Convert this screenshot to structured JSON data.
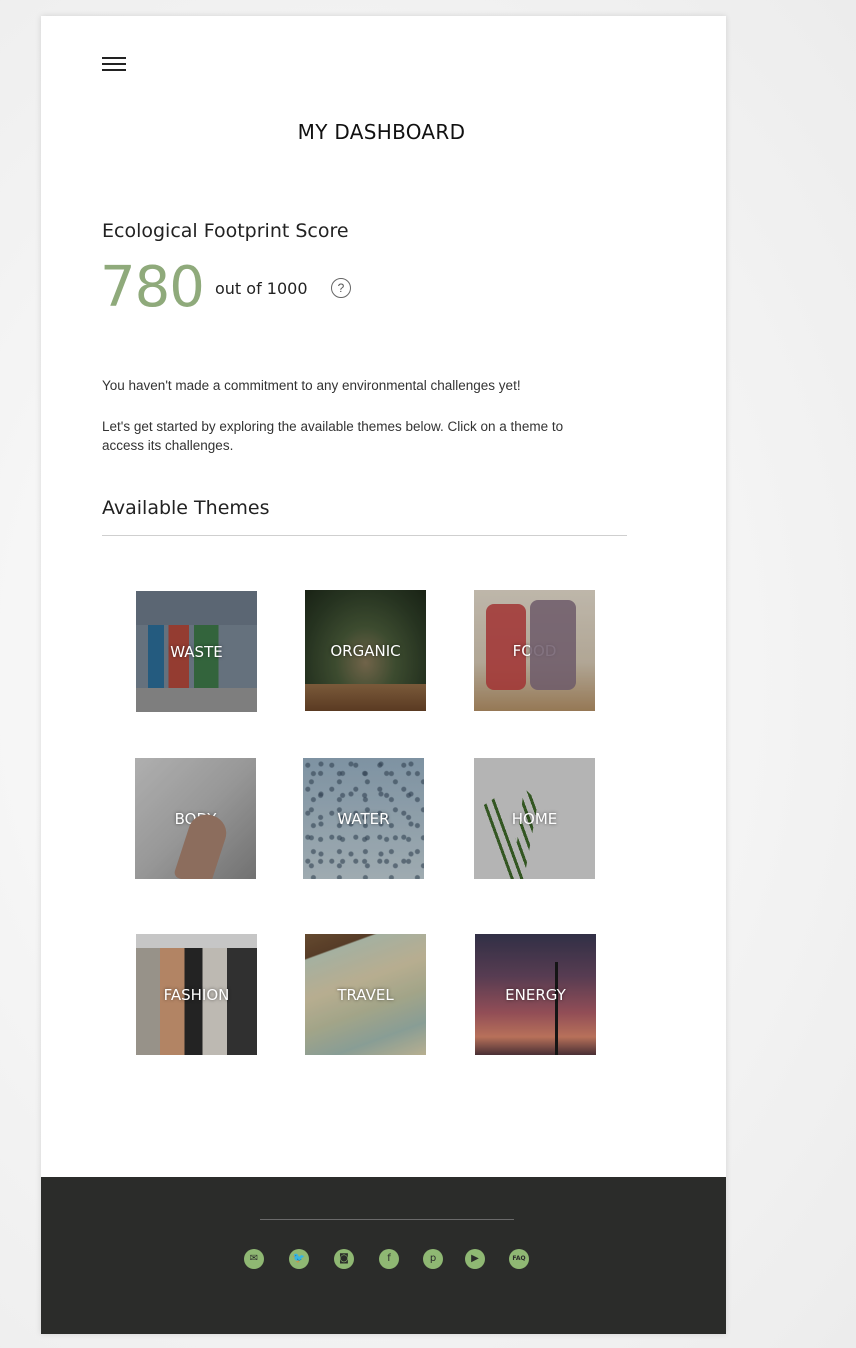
{
  "header": {
    "title": "MY DASHBOARD"
  },
  "score": {
    "heading": "Ecological Footprint Score",
    "value": "780",
    "out_of": "out of 1000",
    "help_symbol": "?"
  },
  "messages": {
    "no_commitment": "You haven't made a commitment to any environmental challenges yet!",
    "get_started": "Let's get started by exploring the available themes below. Click on a theme to access its challenges."
  },
  "themes": {
    "heading": "Available Themes",
    "items": [
      {
        "label": "WASTE"
      },
      {
        "label": "ORGANIC"
      },
      {
        "label": "FOOD"
      },
      {
        "label": "BODY"
      },
      {
        "label": "WATER"
      },
      {
        "label": "HOME"
      },
      {
        "label": "FASHION"
      },
      {
        "label": "TRAVEL"
      },
      {
        "label": "ENERGY"
      }
    ]
  },
  "footer": {
    "social_icons": [
      {
        "name": "email-icon",
        "glyph": "✉"
      },
      {
        "name": "twitter-icon",
        "glyph": "🐦"
      },
      {
        "name": "instagram-icon",
        "glyph": "◙"
      },
      {
        "name": "facebook-icon",
        "glyph": "f"
      },
      {
        "name": "pinterest-icon",
        "glyph": "p"
      },
      {
        "name": "youtube-icon",
        "glyph": "▶"
      },
      {
        "name": "faq-icon",
        "glyph": "FAQ"
      }
    ],
    "icon_color": "#8fb873"
  },
  "colors": {
    "score_accent": "#8faa7b",
    "footer_bg": "#2b2c2a"
  }
}
